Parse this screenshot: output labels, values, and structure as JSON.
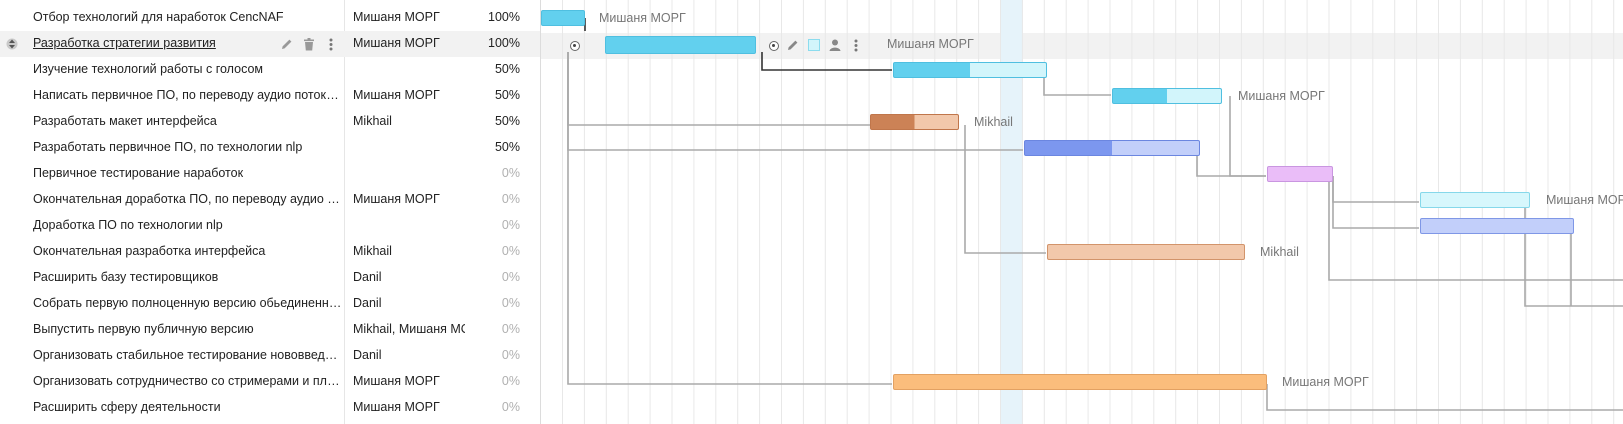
{
  "tasks": [
    {
      "name": "Отбор технологий для наработок CencNAF",
      "owner": "Мишаня МОРГ",
      "pct": "100%"
    },
    {
      "name": "Разработка стратегии развития",
      "owner": "Мишаня МОРГ",
      "pct": "100%"
    },
    {
      "name": "Изучение технологий работы с голосом",
      "owner": "",
      "pct": "50%"
    },
    {
      "name": "Написать первичное ПО, по переводу аудио потока в текст",
      "owner": "Мишаня МОРГ",
      "pct": "50%"
    },
    {
      "name": "Разработать макет интерфейса",
      "owner": "Mikhail",
      "pct": "50%"
    },
    {
      "name": "Разработать первичное ПО, по технологии nlp",
      "owner": "",
      "pct": "50%"
    },
    {
      "name": "Первичное тестирование наработок",
      "owner": "",
      "pct": "0%"
    },
    {
      "name": "Окончательная доработка ПО, по переводу аудио потока в текст",
      "owner": "Мишаня МОРГ",
      "pct": "0%"
    },
    {
      "name": "Доработка ПО по технологии nlp",
      "owner": "",
      "pct": "0%"
    },
    {
      "name": "Окончательная разработка интерфейса",
      "owner": "Mikhail",
      "pct": "0%"
    },
    {
      "name": "Расширить базу тестировщиков",
      "owner": "Danil",
      "pct": "0%"
    },
    {
      "name": "Собрать первую полноценную версию  обьединенного ПО",
      "owner": "Danil",
      "pct": "0%"
    },
    {
      "name": "Выпустить первую публичную версию",
      "owner": "Mikhail, Мишаня МОРГ",
      "pct": "0%"
    },
    {
      "name": "Организовать стабильное тестирование нововведений",
      "owner": "Danil",
      "pct": "0%"
    },
    {
      "name": "Организовать сотрудничество со стримерами и площадками",
      "owner": "Мишаня МОРГ",
      "pct": "0%"
    },
    {
      "name": "Расширить сферу деятельности",
      "owner": "Мишаня МОРГ",
      "pct": "0%"
    }
  ],
  "bar_labels": {
    "b0": "Мишаня МОРГ",
    "b1": "Мишаня МОРГ",
    "b3": "Мишаня МОРГ",
    "b4": "Mikhail",
    "b7": "Мишаня МОРГ",
    "b9": "Mikhail",
    "b14": "Мишаня МОРГ"
  },
  "icons": {
    "drag": "drag-handle-icon",
    "edit": "pencil-icon",
    "delete": "trash-icon",
    "more": "more-vertical-icon",
    "link": "link-circle-icon",
    "color": "color-square-icon",
    "assign": "user-icon"
  },
  "colors": {
    "blue_done": "#62d0ee",
    "blue_todo": "#d2f5fb",
    "blue_border": "#4fbfe0",
    "orange_done": "#cc8256",
    "orange_todo": "#f2c8ab",
    "indigo_done": "#7c97ef",
    "indigo_todo": "#c2cffa",
    "violet": "#eabdf8",
    "cyan_light": "#d7f7fc",
    "peach": "#fbbd7c",
    "today": "#e6f3fa"
  }
}
